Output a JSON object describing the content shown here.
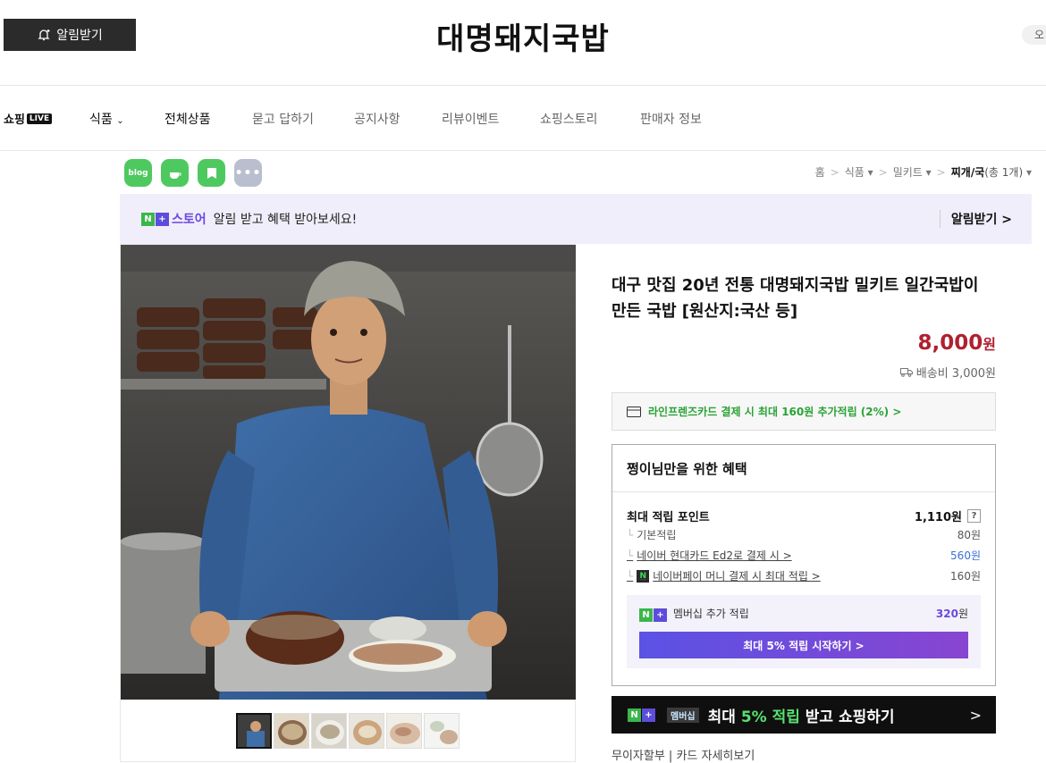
{
  "header": {
    "notify_label": "알림받기",
    "store_title": "대명돼지국밥",
    "login_label": "오"
  },
  "nav": {
    "logo": "쇼핑",
    "live": "LIVE",
    "items": [
      "식품",
      "전체상품",
      "묻고 답하기",
      "공지사항",
      "리뷰이벤트",
      "쇼핑스토리",
      "판매자 정보"
    ]
  },
  "sns": {
    "blog": "blog",
    "more": "•••"
  },
  "breadcrumb": {
    "home": "홈",
    "level1": "식품",
    "level2": "밀키트",
    "current": "찌개/국",
    "count": "(총 1개)"
  },
  "alarm_banner": {
    "store_label": "스토어",
    "text": "알림 받고 혜택 받아보세요!",
    "button": "알림받기"
  },
  "product": {
    "title": "대구 맛집 20년 전통 대명돼지국밥 밀키트 일간국밥이 만든 국밥 [원산지:국산 등]",
    "price": "8,000",
    "currency": "원",
    "shipping": "배송비 3,000원",
    "card_offer": "라인프렌즈카드 결제 시 최대 160원 추가적립 (2%) >"
  },
  "benefits": {
    "title": "쩡이님만을 위한 혜택",
    "max_points_label": "최대 적립 포인트",
    "max_points_value": "1,110원",
    "help": "?",
    "rows": [
      {
        "label": "기본적립",
        "value": "80원"
      },
      {
        "label": "네이버 현대카드 Ed2로 결제 시 >",
        "value": "560원"
      },
      {
        "label": "네이버페이 머니 결제 시 최대 적립 >",
        "value": "160원"
      }
    ],
    "membership_label": "멤버십 추가 적립",
    "membership_value": "320",
    "membership_unit": "원",
    "membership_button": "최대 5% 적립 시작하기 >"
  },
  "shop_banner": {
    "badge": "멤버십",
    "prefix": "최대",
    "highlight": "5% 적립",
    "suffix": "받고 쇼핑하기",
    "arrow": ">"
  },
  "cutoff_text": "무이자할부 | 카드 자세히보기"
}
